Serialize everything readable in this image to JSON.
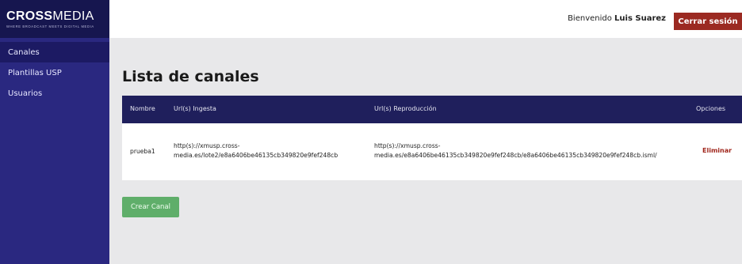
{
  "brand": {
    "name_bold": "CROSS",
    "name_light": "MEDIA",
    "tagline": "WHERE BROADCAST MEETS DIGITAL MEDIA"
  },
  "sidebar": {
    "items": [
      {
        "label": "Canales",
        "active": true
      },
      {
        "label": "Plantillas USP",
        "active": false
      },
      {
        "label": "Usuarios",
        "active": false
      }
    ]
  },
  "header": {
    "welcome_prefix": "Bienvenido",
    "user_name": "Luis Suarez",
    "logout_label": "Cerrar sesión"
  },
  "main": {
    "title": "Lista de canales",
    "columns": [
      "Nombre",
      "Url(s) Ingesta",
      "Url(s) Reproducción",
      "Opciones"
    ],
    "rows": [
      {
        "name": "prueba1",
        "ingest_line1": "http(s)://xmusp.cross-",
        "ingest_line2": "media.es/lote2/e8a6406be46135cb349820e9fef248cb",
        "playback_line1": "http(s)://xmusp.cross-",
        "playback_line2": "media.es/e8a6406be46135cb349820e9fef248cb/e8a6406be46135cb349820e9fef248cb.isml/",
        "action": "Eliminar"
      }
    ],
    "create_label": "Crear Canal"
  },
  "colors": {
    "sidebar": "#2a2880",
    "brand_bg": "#16164f",
    "table_header": "#1f1f5c",
    "logout": "#9b2a22",
    "delete": "#a0261c",
    "create": "#5fae6a"
  }
}
